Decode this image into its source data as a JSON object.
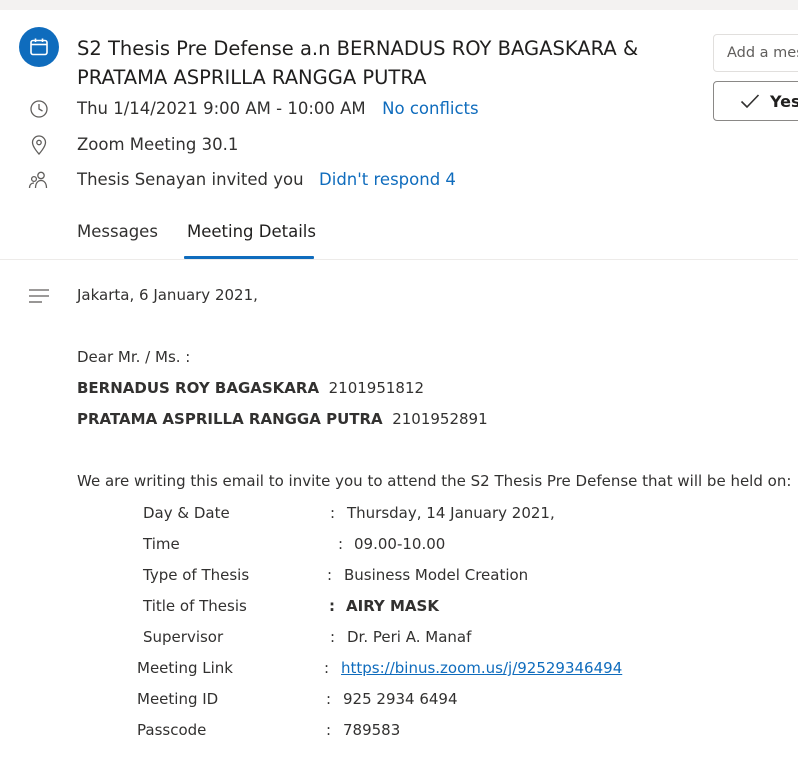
{
  "header": {
    "title_line1": "S2 Thesis Pre Defense a.n BERNADUS ROY BAGASKARA &",
    "title_line2": "PRATAMA ASPRILLA RANGGA PUTRA",
    "datetime": "Thu 1/14/2021 9:00 AM - 10:00 AM",
    "conflicts": "No conflicts",
    "location": "Zoom Meeting 30.1",
    "invited_by": "Thesis Senayan invited you",
    "response_status": "Didn't respond 4"
  },
  "actions": {
    "message_placeholder": "Add a message",
    "yes_label": "Yes"
  },
  "tabs": [
    {
      "label": "Messages",
      "active": false
    },
    {
      "label": "Meeting Details",
      "active": true
    }
  ],
  "body": {
    "place_date": "Jakarta, 6 January 2021,",
    "salutation": "Dear Mr. / Ms. :",
    "students": [
      {
        "name": "BERNADUS ROY BAGASKARA",
        "id": "2101951812"
      },
      {
        "name": "PRATAMA ASPRILLA RANGGA PUTRA",
        "id": "2101952891"
      }
    ],
    "intro": "We are writing this email to invite you to attend the S2 Thesis Pre Defense that will be held on:",
    "details": [
      {
        "label": "Day & Date",
        "value": "Thursday, 14 January 2021,"
      },
      {
        "label": "Time",
        "value": "09.00-10.00"
      },
      {
        "label": "Type of Thesis",
        "value": "Business Model Creation"
      },
      {
        "label": "Title of Thesis",
        "value": "AIRY MASK"
      },
      {
        "label": "Supervisor",
        "value": "Dr. Peri A. Manaf"
      },
      {
        "label": "Meeting Link",
        "value": "https://binus.zoom.us/j/92529346494"
      },
      {
        "label": "Meeting ID",
        "value": "925 2934 6494"
      },
      {
        "label": "Passcode",
        "value": "789583"
      }
    ]
  },
  "colors": {
    "accent": "#0f6cbd",
    "text": "#323130"
  },
  "icons": [
    "calendar-icon",
    "clock-icon",
    "location-pin-icon",
    "people-icon",
    "checkmark-icon",
    "text-lines-icon"
  ]
}
